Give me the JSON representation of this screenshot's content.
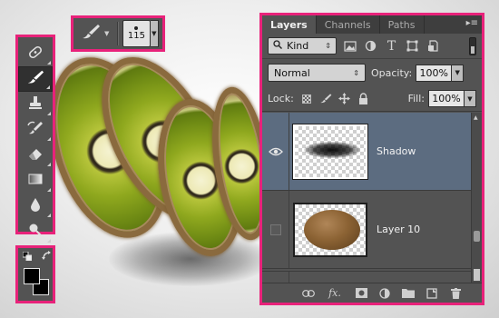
{
  "brush_options": {
    "tool_icon": "brush-icon",
    "size_value": "115"
  },
  "tools": [
    {
      "name": "spot-healing-brush-icon"
    },
    {
      "name": "brush-icon",
      "active": true
    },
    {
      "name": "clone-stamp-icon"
    },
    {
      "name": "history-brush-icon"
    },
    {
      "name": "eraser-icon"
    },
    {
      "name": "gradient-icon"
    },
    {
      "name": "blur-icon"
    },
    {
      "name": "dodge-icon"
    }
  ],
  "colors": {
    "foreground": "#000000",
    "background": "#000000"
  },
  "layers_panel": {
    "tabs": [
      "Layers",
      "Channels",
      "Paths"
    ],
    "active_tab": "Layers",
    "filter": {
      "kind_label": "Kind"
    },
    "blend_mode": "Normal",
    "opacity_label": "Opacity:",
    "opacity_value": "100%",
    "lock_label": "Lock:",
    "fill_label": "Fill:",
    "fill_value": "100%",
    "layers": [
      {
        "name": "Shadow",
        "visible": true,
        "selected": true
      },
      {
        "name": "Layer 10",
        "visible": false,
        "selected": false
      }
    ]
  },
  "accent_color": "#e8227a",
  "selection_color": "#5c6c80"
}
